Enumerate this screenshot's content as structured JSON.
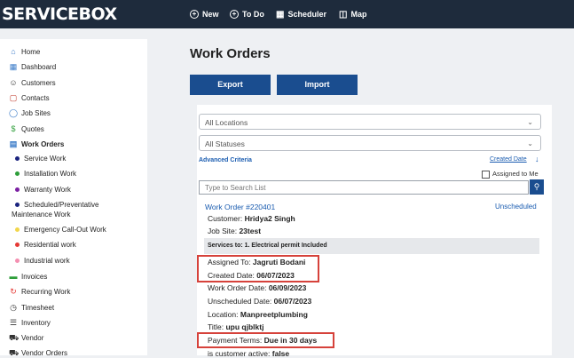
{
  "app": {
    "logo": "SERVICEBOX"
  },
  "topnav": [
    {
      "label": "New",
      "icon": "plus-circle-icon"
    },
    {
      "label": "To Do",
      "icon": "plus-circle-icon"
    },
    {
      "label": "Scheduler",
      "icon": "calendar-icon"
    },
    {
      "label": "Map",
      "icon": "map-icon"
    }
  ],
  "sidebar": {
    "items": [
      {
        "label": "Home",
        "icon": "home-icon"
      },
      {
        "label": "Dashboard",
        "icon": "dashboard-icon"
      },
      {
        "label": "Customers",
        "icon": "customers-icon"
      },
      {
        "label": "Contacts",
        "icon": "contacts-icon"
      },
      {
        "label": "Job Sites",
        "icon": "location-pin-icon"
      },
      {
        "label": "Quotes",
        "icon": "dollar-icon"
      },
      {
        "label": "Work Orders",
        "icon": "document-icon"
      }
    ],
    "sub_items": [
      {
        "label": "Service Work",
        "color": "#1a237e"
      },
      {
        "label": "Installation Work",
        "color": "#2e9e3a"
      },
      {
        "label": "Warranty Work",
        "color": "#7b1fa2"
      },
      {
        "label": "Scheduled/Preventative",
        "color": "#1a237e"
      },
      {
        "label": "Emergency Call-Out Work",
        "color": "#f2d64b"
      },
      {
        "label": "Residential work",
        "color": "#e53935"
      },
      {
        "label": "Industrial work",
        "color": "#f48fb1"
      }
    ],
    "sub_item_cont": "Maintenance Work",
    "items_bottom": [
      {
        "label": "Invoices",
        "icon": "invoice-icon"
      },
      {
        "label": "Recurring Work",
        "icon": "recurring-icon"
      },
      {
        "label": "Timesheet",
        "icon": "timesheet-icon"
      },
      {
        "label": "Inventory",
        "icon": "inventory-icon"
      },
      {
        "label": "Vendor",
        "icon": "truck-icon"
      },
      {
        "label": "Vendor Orders",
        "icon": "truck-icon"
      }
    ]
  },
  "main": {
    "title": "Work Orders",
    "export_label": "Export",
    "import_label": "Import",
    "locations_select": "All Locations",
    "statuses_select": "All Statuses",
    "advanced_criteria": "Advanced Criteria",
    "sort_label": "Created Date",
    "assigned_to_me": "Assigned to Me",
    "search_placeholder": "Type to Search List"
  },
  "work_order": {
    "number": "Work Order #220401",
    "status": "Unscheduled",
    "customer_label": "Customer:",
    "customer": "Hridya2 Singh",
    "job_site_label": "Job Site:",
    "job_site": "23test",
    "services": "Services to: 1. Electrical permit Included",
    "assigned_to_label": "Assigned To:",
    "assigned_to": "Jagruti Bodani",
    "created_date_label": "Created Date:",
    "created_date": "06/07/2023",
    "wo_date_label": "Work Order Date:",
    "wo_date": "06/09/2023",
    "unscheduled_date_label": "Unscheduled Date:",
    "unscheduled_date": "06/07/2023",
    "location_label": "Location:",
    "location": "Manpreetplumbing",
    "title_label": "Title:",
    "title": "upu qjblktj",
    "payment_terms_label": "Payment Terms:",
    "payment_terms": "Due in 30 days",
    "customer_active_label": "is customer active:",
    "customer_active": "false"
  },
  "colors": {
    "topbar": "#1e2b3c",
    "primary_button": "#1a4d8f",
    "highlight": "#d6423b",
    "link": "#1a5cb0"
  }
}
